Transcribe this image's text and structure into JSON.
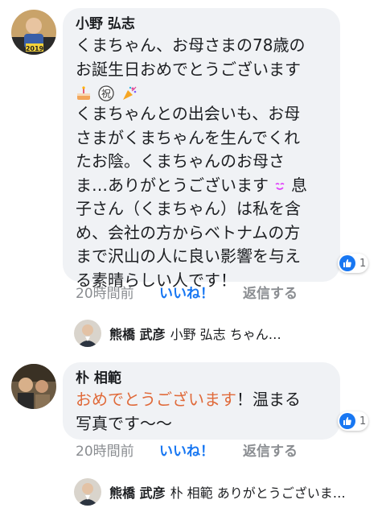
{
  "comments": [
    {
      "author": "小野 弘志",
      "lines": [
        "くまちゃん、お母さまの78歳の",
        "お誕生日おめでとうございます"
      ],
      "emojis": [
        "birthday-cake-emoji",
        "celebrate-kanji-emoji",
        "party-popper-emoji"
      ],
      "emoji_celebrate_char": "祝",
      "lines2": [
        "くまちゃんとの出会いも、お母",
        "さまがくまちゃんを生んでくれ",
        "たお陰。くまちゃんのお母さ",
        "ま…ありがとうございます",
        "子さん（くまちゃん）は私を含",
        "め、会社の方からベトナムの方",
        "まで沢山の人に良い影響を与え",
        "る素晴らしい人です！"
      ],
      "line_smile_suffix": "息",
      "reaction_count": "1",
      "timestamp": "20時間前",
      "like_label": "いいね！",
      "reply_label": "返信する",
      "reply_preview": {
        "author": "熊橋 武彦",
        "snippet": "小野 弘志 ちゃん…"
      }
    },
    {
      "author": "朴 相範",
      "highlight": "おめでとうございます",
      "line1_rest": "！温まる",
      "line2": "写真です〜〜",
      "reaction_count": "1",
      "timestamp": "20時間前",
      "like_label": "いいね！",
      "reply_label": "返信する",
      "reply_preview": {
        "author": "熊橋 武彦",
        "snippet": "朴 相範 ありがとうございま…"
      }
    }
  ],
  "colors": {
    "bubble": "#f0f2f5",
    "like_blue": "#1877f2",
    "meta_gray": "#8a8d91",
    "highlight_orange": "#e06a3a"
  }
}
